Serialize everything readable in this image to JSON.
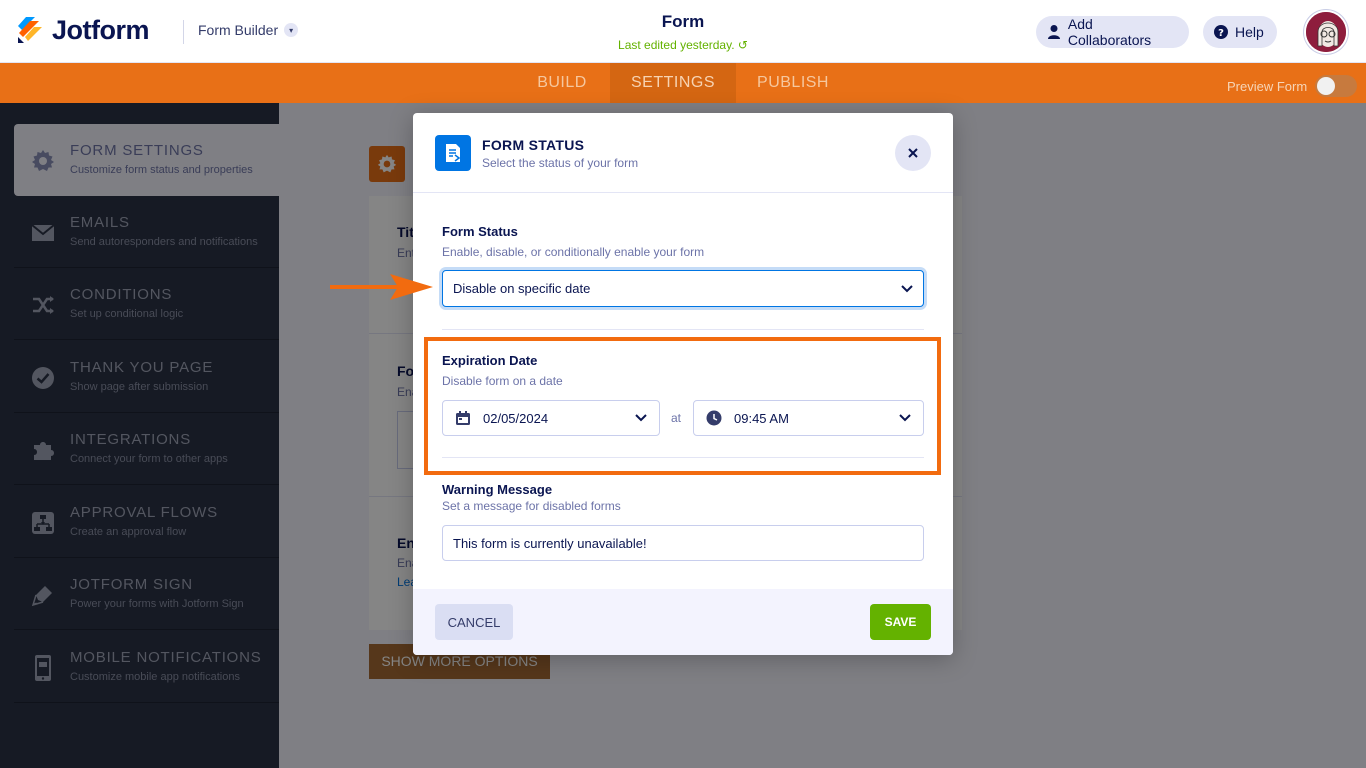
{
  "header": {
    "brand": "Jotform",
    "builder_switch": "Form Builder",
    "form_title": "Form",
    "last_edited": "Last edited yesterday.",
    "add_collaborators": "Add Collaborators",
    "help": "Help"
  },
  "tabs": {
    "build": "BUILD",
    "settings": "SETTINGS",
    "publish": "PUBLISH",
    "preview_label": "Preview Form"
  },
  "sidebar": {
    "items": [
      {
        "title": "FORM SETTINGS",
        "subtitle": "Customize form status and properties",
        "icon": "gear-icon"
      },
      {
        "title": "EMAILS",
        "subtitle": "Send autoresponders and notifications",
        "icon": "envelope-icon"
      },
      {
        "title": "CONDITIONS",
        "subtitle": "Set up conditional logic",
        "icon": "shuffle-icon"
      },
      {
        "title": "THANK YOU PAGE",
        "subtitle": "Show page after submission",
        "icon": "check-circle-icon"
      },
      {
        "title": "INTEGRATIONS",
        "subtitle": "Connect your form to other apps",
        "icon": "puzzle-icon"
      },
      {
        "title": "APPROVAL FLOWS",
        "subtitle": "Create an approval flow",
        "icon": "flow-icon"
      },
      {
        "title": "JOTFORM SIGN",
        "subtitle": "Power your forms with Jotform Sign",
        "icon": "pen-icon"
      },
      {
        "title": "MOBILE NOTIFICATIONS",
        "subtitle": "Customize mobile app notifications",
        "icon": "phone-icon"
      }
    ]
  },
  "background": {
    "title_partial": "Tit",
    "title_desc_partial": "Ent",
    "form_partial": "Fo",
    "form_desc_partial": "Ena",
    "en_partial": "En",
    "en_desc_partial": "Ena",
    "learn_partial": "Lea",
    "show_more": "SHOW MORE OPTIONS"
  },
  "modal": {
    "title": "FORM STATUS",
    "subtitle": "Select the status of your form",
    "form_status_label": "Form Status",
    "form_status_desc": "Enable, disable, or conditionally enable your form",
    "form_status_value": "Disable on specific date",
    "expiration_label": "Expiration Date",
    "expiration_desc": "Disable form on a date",
    "date_value": "02/05/2024",
    "at_label": "at",
    "time_value": "09:45 AM",
    "warning_label": "Warning Message",
    "warning_desc": "Set a message for disabled forms",
    "warning_value": "This form is currently unavailable!",
    "cancel": "CANCEL",
    "save": "SAVE"
  },
  "colors": {
    "accent_orange": "#e87017",
    "sidebar_bg": "#2b3245",
    "primary_blue": "#0075e3",
    "save_green": "#64b200",
    "annotation_orange": "#f26b0f"
  }
}
